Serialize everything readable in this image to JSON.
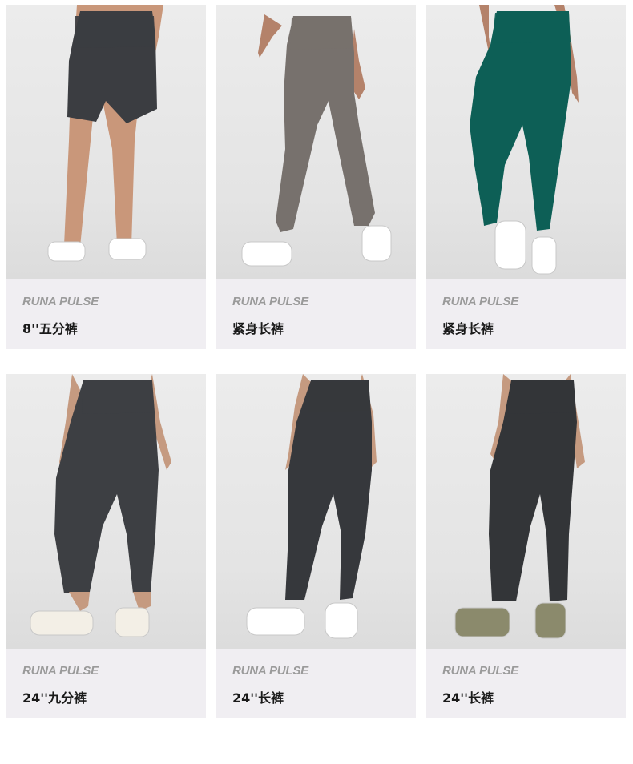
{
  "products": [
    {
      "brand": "RUNA PULSE",
      "name": "8''五分裤",
      "color": "#3b3d41",
      "style": "shorts",
      "shoe": "#ffffff"
    },
    {
      "brand": "RUNA PULSE",
      "name": "紧身长裤",
      "color": "#77716d",
      "style": "walking",
      "shoe": "#ffffff"
    },
    {
      "brand": "RUNA PULSE",
      "name": "紧身长裤",
      "color": "#0d5f56",
      "style": "walking",
      "shoe": "#ffffff"
    },
    {
      "brand": "RUNA PULSE",
      "name": "24''九分裤",
      "color": "#3d3f43",
      "style": "ankle",
      "shoe": "#f3efe6"
    },
    {
      "brand": "RUNA PULSE",
      "name": "24''长裤",
      "color": "#36383c",
      "style": "full",
      "shoe": "#ffffff"
    },
    {
      "brand": "RUNA PULSE",
      "name": "24''长裤",
      "color": "#333538",
      "style": "full",
      "shoe": "#8b8a6c"
    }
  ]
}
